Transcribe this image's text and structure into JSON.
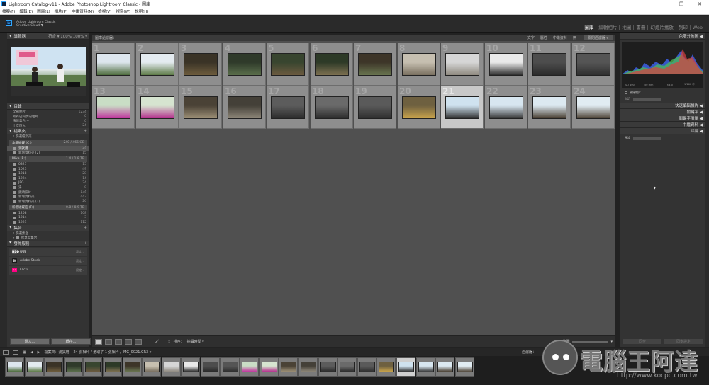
{
  "window": {
    "title": "Lightroom Catalog-v11 - Adobe Photoshop Lightroom Classic - 圖庫",
    "controls": [
      "─",
      "❐",
      "✕"
    ]
  },
  "menu": [
    "檔案(F)",
    "編輯(E)",
    "圖庫(L)",
    "相片(P)",
    "中繼資料(M)",
    "檢視(V)",
    "視窗(W)",
    "說明(H)"
  ],
  "identity": {
    "line1": "Adobe Lightroom Classic",
    "line2": "Creative Cloud",
    "badge": "Lr",
    "arrow": "▼"
  },
  "modules": [
    {
      "label": "圖庫",
      "active": true
    },
    {
      "label": "編輯相片",
      "active": false
    },
    {
      "label": "地圖",
      "active": false
    },
    {
      "label": "書冊",
      "active": false
    },
    {
      "label": "幻燈片播放",
      "active": false
    },
    {
      "label": "列印",
      "active": false
    },
    {
      "label": "Web",
      "active": false
    }
  ],
  "navigator": {
    "title": "導覽器",
    "options": "符合 ▾   100%   100% ▾"
  },
  "catalog": {
    "title": "目錄",
    "items": [
      {
        "label": "全部相片",
        "count": "1234"
      },
      {
        "label": "所有已同步的相片",
        "count": "0"
      },
      {
        "label": "快速集合 +",
        "count": "0"
      },
      {
        "label": "上次匯入",
        "count": "24"
      }
    ]
  },
  "folders": {
    "title": "檔案夾",
    "add": "+",
    "search_label": "篩選檔案夾",
    "volumes": [
      {
        "name": "本機磁碟 (C:)",
        "stats": "240 / 465 GB",
        "items": [
          {
            "label": "測試用",
            "count": "24",
            "selected": true
          },
          {
            "label": "新增資料夾 (2)",
            "count": "15",
            "selected": false
          }
        ]
      },
      {
        "name": "Mike (E:)",
        "stats": "1.4 / 1.8 TB",
        "items": [
          {
            "label": "0327",
            "count": "15",
            "selected": false
          },
          {
            "label": "1023",
            "count": "49",
            "selected": false
          },
          {
            "label": "1218",
            "count": "28",
            "selected": false
          },
          {
            "label": "1224",
            "count": "14",
            "selected": false
          },
          {
            "label": "JPG",
            "count": "24",
            "selected": false
          },
          {
            "label": "湯",
            "count": "9",
            "selected": false
          },
          {
            "label": "鏡頭照片",
            "count": "134",
            "selected": false
          },
          {
            "label": "新增資料夾",
            "count": "443",
            "selected": false
          },
          {
            "label": "新增資料夾 (2)",
            "count": "26",
            "selected": false
          }
        ]
      },
      {
        "name": "新增磁碟區 (F:)",
        "stats": "0.8 / 0.9 TB",
        "items": [
          {
            "label": "1208",
            "count": "108",
            "selected": false
          },
          {
            "label": "1214",
            "count": "3",
            "selected": false
          },
          {
            "label": "1221",
            "count": "112",
            "selected": false
          }
        ]
      }
    ]
  },
  "collections": {
    "title": "集合",
    "add": "+",
    "search_label": "篩選集合",
    "smart": "智慧型集合"
  },
  "publish": {
    "title": "發佈服務",
    "add": "+",
    "services": [
      {
        "name": "硬碟",
        "icon": "HDD",
        "color": "#555555",
        "button": "設定..."
      },
      {
        "name": "Adobe Stock",
        "icon": "St",
        "color": "#1a1a1a",
        "button": "設定..."
      },
      {
        "name": "Flickr",
        "icon": "••",
        "color": "#ff0084",
        "button": "設定..."
      }
    ]
  },
  "left_buttons": {
    "import": "匯入...",
    "export": "轉存..."
  },
  "grid_header": {
    "title": "圖庫過濾器：",
    "filters": [
      "文字",
      "屬性",
      "中繼資料",
      "無"
    ],
    "custom": "關閉過濾器 ▾"
  },
  "grid": [
    {
      "n": "1",
      "c1": "#dde6ee",
      "c2": "#4d6b3c",
      "selected": false
    },
    {
      "n": "2",
      "c1": "#e4ebf0",
      "c2": "#5d7a47",
      "selected": false
    },
    {
      "n": "3",
      "c1": "#3a3326",
      "c2": "#6d5c3d",
      "selected": false
    },
    {
      "n": "4",
      "c1": "#2f3a2a",
      "c2": "#5a6e4b",
      "selected": false
    },
    {
      "n": "5",
      "c1": "#38452f",
      "c2": "#6b5a3f",
      "selected": false
    },
    {
      "n": "6",
      "c1": "#2d3a27",
      "c2": "#7c7050",
      "selected": false
    },
    {
      "n": "7",
      "c1": "#3d3528",
      "c2": "#68744f",
      "selected": false
    },
    {
      "n": "8",
      "c1": "#c6bfb0",
      "c2": "#7a7060",
      "selected": false
    },
    {
      "n": "9",
      "c1": "#d6d6d6",
      "c2": "#8f8a80",
      "selected": false
    },
    {
      "n": "10",
      "c1": "#e9e9e9",
      "c2": "#2f2f2f",
      "selected": false
    },
    {
      "n": "11",
      "c1": "#4d4d4d",
      "c2": "#2b2b2b",
      "selected": false
    },
    {
      "n": "12",
      "c1": "#555555",
      "c2": "#303030",
      "selected": false
    },
    {
      "n": "13",
      "c1": "#c9ddc5",
      "c2": "#c0389e",
      "selected": false
    },
    {
      "n": "14",
      "c1": "#d6e4d0",
      "c2": "#b4338e",
      "selected": false
    },
    {
      "n": "15",
      "c1": "#4a4236",
      "c2": "#9b8e75",
      "selected": false
    },
    {
      "n": "16",
      "c1": "#444038",
      "c2": "#8c8577",
      "selected": false
    },
    {
      "n": "17",
      "c1": "#5c5c5c",
      "c2": "#2c2c2c",
      "selected": false
    },
    {
      "n": "18",
      "c1": "#6a6a6a",
      "c2": "#2d2d2d",
      "selected": false
    },
    {
      "n": "19",
      "c1": "#5a5a5a",
      "c2": "#303030",
      "selected": false
    },
    {
      "n": "20",
      "c1": "#6e6040",
      "c2": "#c7a24b",
      "selected": false
    },
    {
      "n": "21",
      "c1": "#cfe2ef",
      "c2": "#333333",
      "selected": true
    },
    {
      "n": "22",
      "c1": "#d7e6f0",
      "c2": "#3a3a3a",
      "selected": false
    },
    {
      "n": "23",
      "c1": "#dce9f1",
      "c2": "#4a4033",
      "selected": false
    },
    {
      "n": "24",
      "c1": "#e1ecf2",
      "c2": "#51473a",
      "selected": false
    }
  ],
  "toolbar": {
    "sort_label": "排序：",
    "sort_value": "拍攝時間 ▾",
    "thumb_label": "縮圖"
  },
  "right": {
    "histogram_title": "色階分佈圖 ◀",
    "histogram_stats": [
      "ISO 400",
      "50 mm",
      "f/4.0",
      "1/160 秒"
    ],
    "original_label": "原始相片",
    "panels": [
      {
        "label": "快速編輯相片 ◀"
      },
      {
        "label": "關鍵字 ◀"
      },
      {
        "label": "關鍵字清單 ◀"
      },
      {
        "label": "中繼資料 ◀"
      },
      {
        "label": "評論 ◀"
      }
    ],
    "saved_preset": "自訂",
    "default_label": "預設",
    "sync_buttons": [
      "同步",
      "同步設定"
    ]
  },
  "filmstrip_bar": {
    "path": "檔案夾：測試用",
    "info": "24 張相片 / 選取了 1 張相片 / IMG_0021.CR3 ▾",
    "filter_label": "過濾器："
  },
  "filmstrip": [
    {
      "c1": "#dde6ee",
      "c2": "#4d6b3c",
      "selected": false
    },
    {
      "c1": "#e4ebf0",
      "c2": "#5d7a47",
      "selected": false
    },
    {
      "c1": "#3a3326",
      "c2": "#6d5c3d",
      "selected": false
    },
    {
      "c1": "#2f3a2a",
      "c2": "#5a6e4b",
      "selected": false
    },
    {
      "c1": "#38452f",
      "c2": "#6b5a3f",
      "selected": false
    },
    {
      "c1": "#2d3a27",
      "c2": "#7c7050",
      "selected": false
    },
    {
      "c1": "#3d3528",
      "c2": "#68744f",
      "selected": false
    },
    {
      "c1": "#c6bfb0",
      "c2": "#7a7060",
      "selected": false
    },
    {
      "c1": "#d6d6d6",
      "c2": "#8f8a80",
      "selected": false
    },
    {
      "c1": "#e9e9e9",
      "c2": "#2f2f2f",
      "selected": false
    },
    {
      "c1": "#4d4d4d",
      "c2": "#2b2b2b",
      "selected": false
    },
    {
      "c1": "#555555",
      "c2": "#303030",
      "selected": false
    },
    {
      "c1": "#c9ddc5",
      "c2": "#c0389e",
      "selected": false
    },
    {
      "c1": "#d6e4d0",
      "c2": "#b4338e",
      "selected": false
    },
    {
      "c1": "#4a4236",
      "c2": "#9b8e75",
      "selected": false
    },
    {
      "c1": "#444038",
      "c2": "#8c8577",
      "selected": false
    },
    {
      "c1": "#5c5c5c",
      "c2": "#2c2c2c",
      "selected": false
    },
    {
      "c1": "#6a6a6a",
      "c2": "#2d2d2d",
      "selected": false
    },
    {
      "c1": "#5a5a5a",
      "c2": "#303030",
      "selected": false
    },
    {
      "c1": "#6e6040",
      "c2": "#c7a24b",
      "selected": false
    },
    {
      "c1": "#cfe2ef",
      "c2": "#333333",
      "selected": true
    },
    {
      "c1": "#d7e6f0",
      "c2": "#3a3a3a",
      "selected": false
    },
    {
      "c1": "#dce9f1",
      "c2": "#4a4033",
      "selected": false
    },
    {
      "c1": "#e1ecf2",
      "c2": "#51473a",
      "selected": false
    }
  ],
  "watermark": {
    "title": "電腦王阿達",
    "url": "http://www.kocpc.com.tw"
  }
}
